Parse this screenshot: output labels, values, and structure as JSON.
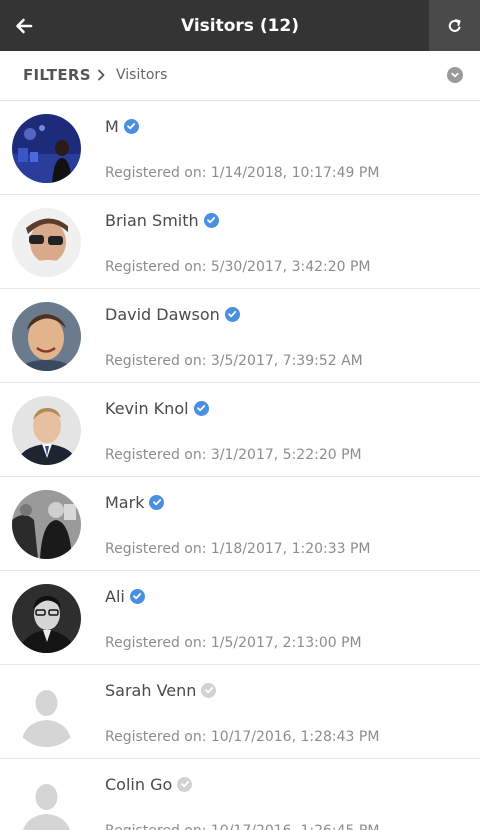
{
  "header": {
    "title": "Visitors (12)",
    "back_icon": "arrow-left-icon",
    "refresh_icon": "refresh-icon",
    "bar_color": "#343434",
    "refresh_bg": "#4a4a4a"
  },
  "filter_bar": {
    "filters_label": "FILTERS",
    "separator_icon": "chevron-right-icon",
    "current": "Visitors",
    "toggle_icon": "chevron-down-circle-icon"
  },
  "colors": {
    "verified": "#4a90e2",
    "unverified": "#d2d2d2"
  },
  "visitors": [
    {
      "name": "M",
      "registered": "Registered on: 1/14/2018, 10:17:49 PM",
      "verified": true,
      "avatar": "photo-night-city"
    },
    {
      "name": "Brian Smith",
      "registered": "Registered on: 5/30/2017, 3:42:20 PM",
      "verified": true,
      "avatar": "photo-sunglasses"
    },
    {
      "name": "David Dawson",
      "registered": "Registered on: 3/5/2017, 7:39:52 AM",
      "verified": true,
      "avatar": "photo-smiling"
    },
    {
      "name": "Kevin Knol",
      "registered": "Registered on: 3/1/2017, 5:22:20 PM",
      "verified": true,
      "avatar": "photo-suit"
    },
    {
      "name": "Mark",
      "registered": "Registered on: 1/18/2017, 1:20:33 PM",
      "verified": true,
      "avatar": "photo-group-bw"
    },
    {
      "name": "Ali",
      "registered": "Registered on: 1/5/2017, 2:13:00 PM",
      "verified": true,
      "avatar": "photo-portrait-bw"
    },
    {
      "name": "Sarah Venn",
      "registered": "Registered on: 10/17/2016, 1:28:43 PM",
      "verified": false,
      "avatar": "default-user-silhouette"
    },
    {
      "name": "Colin Go",
      "registered": "Registered on: 10/17/2016, 1:26:45 PM",
      "verified": false,
      "avatar": "default-user-silhouette"
    }
  ]
}
